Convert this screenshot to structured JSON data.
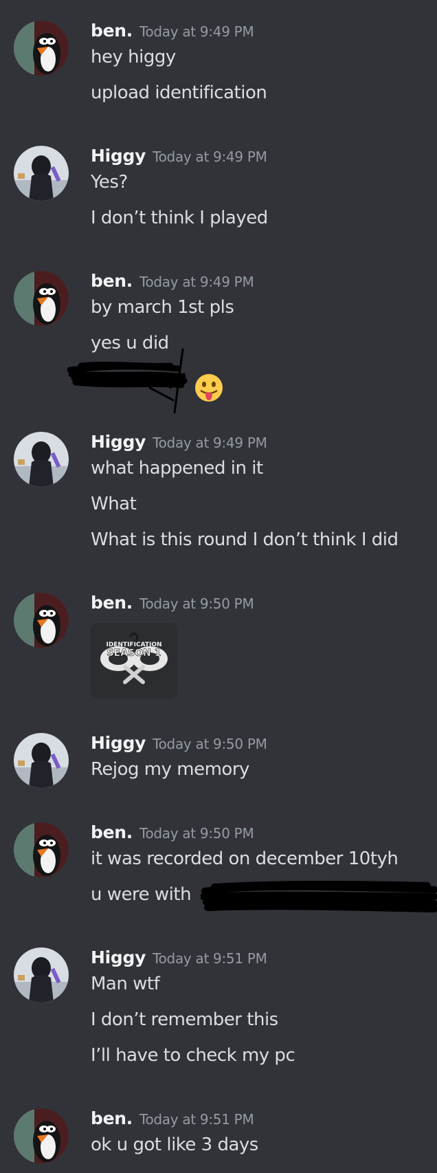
{
  "users": {
    "ben": "ben.",
    "higgy": "Higgy"
  },
  "groups": [
    {
      "author": "ben.",
      "timestamp": "Today at 9:49 PM",
      "lines": [
        "hey higgy",
        "upload identification"
      ]
    },
    {
      "author": "Higgy",
      "timestamp": "Today at 9:49 PM",
      "lines": [
        "Yes?",
        "I don’t think I played"
      ]
    },
    {
      "author": "ben.",
      "timestamp": "Today at 9:49 PM",
      "lines": [
        "by march 1st pls",
        "yes u did"
      ],
      "emoji": "face-with-tongue"
    },
    {
      "author": "Higgy",
      "timestamp": "Today at 9:49 PM",
      "lines": [
        "what happened in it",
        "What",
        "What is this round I don’t think I did"
      ]
    },
    {
      "author": "ben.",
      "timestamp": "Today at 9:50 PM",
      "attachment": {
        "text_top": "IDENTIFICATION",
        "text_bottom": "SEASON 1",
        "icon": "crossed-keys-icon"
      }
    },
    {
      "author": "Higgy",
      "timestamp": "Today at 9:50 PM",
      "lines": [
        "Rejog my memory"
      ]
    },
    {
      "author": "ben.",
      "timestamp": "Today at 9:50 PM",
      "lines": [
        "it was recorded on december 10tyh",
        "u were with"
      ]
    },
    {
      "author": "Higgy",
      "timestamp": "Today at 9:51 PM",
      "lines": [
        "Man wtf",
        "I don’t remember this",
        "I’ll have to check my pc"
      ]
    },
    {
      "author": "ben.",
      "timestamp": "Today at 9:51 PM",
      "lines": [
        "ok u got like 3 days"
      ]
    }
  ],
  "colors": {
    "background": "#313338",
    "author": "#f2f3f5",
    "timestamp": "#949ba4",
    "text": "#dbdee1"
  }
}
